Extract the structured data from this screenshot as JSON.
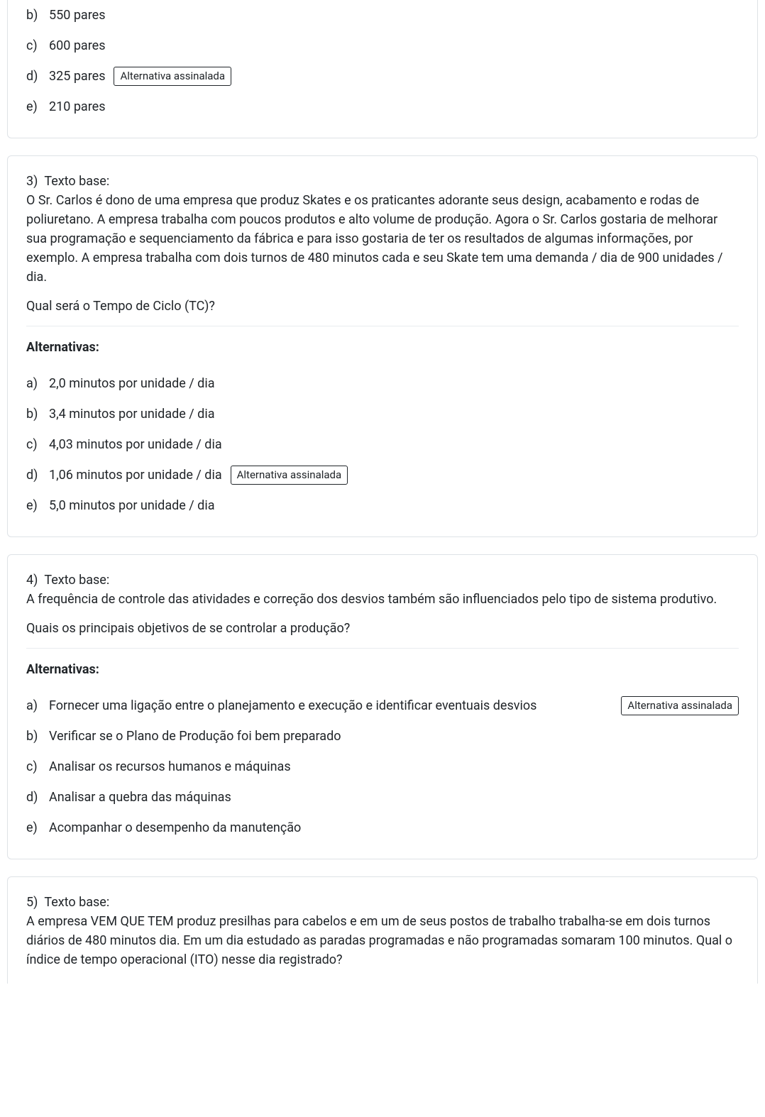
{
  "badgeLabel": "Alternativa assinalada",
  "q2": {
    "alts": [
      {
        "letter": "b)",
        "text": "550 pares",
        "marked": false
      },
      {
        "letter": "c)",
        "text": "600 pares",
        "marked": false
      },
      {
        "letter": "d)",
        "text": "325 pares",
        "marked": true
      },
      {
        "letter": "e)",
        "text": "210 pares",
        "marked": false
      }
    ]
  },
  "q3": {
    "number": "3)",
    "baseLabel": "Texto base:",
    "baseText": "O Sr. Carlos é dono de uma empresa que produz Skates e os praticantes adorante seus design, acabamento e rodas de poliuretano. A empresa trabalha com poucos produtos e alto volume de produção. Agora o Sr. Carlos gostaria de melhorar sua programação e sequenciamento da fábrica e para isso gostaria de ter os resultados de algumas informações, por exemplo. A empresa trabalha com dois turnos de 480 minutos cada e seu Skate tem uma demanda / dia de 900 unidades / dia.",
    "prompt": "Qual será o Tempo de Ciclo (TC)?",
    "altHeading": "Alternativas:",
    "alts": [
      {
        "letter": "a)",
        "text": "2,0 minutos por unidade / dia",
        "marked": false
      },
      {
        "letter": "b)",
        "text": "3,4 minutos por unidade / dia",
        "marked": false
      },
      {
        "letter": "c)",
        "text": "4,03 minutos por unidade / dia",
        "marked": false
      },
      {
        "letter": "d)",
        "text": "1,06 minutos por unidade / dia",
        "marked": true
      },
      {
        "letter": "e)",
        "text": "5,0 minutos por unidade / dia",
        "marked": false
      }
    ]
  },
  "q4": {
    "number": "4)",
    "baseLabel": "Texto base:",
    "baseText": "A frequência de controle das atividades e correção dos desvios também são influenciados pelo tipo de sistema produtivo.",
    "prompt": "Quais os principais objetivos de se controlar a produção?",
    "altHeading": "Alternativas:",
    "alts": [
      {
        "letter": "a)",
        "text": "Fornecer uma ligação entre o planejamento e execução e identificar eventuais desvios",
        "marked": true,
        "wide": true
      },
      {
        "letter": "b)",
        "text": "Verificar se o Plano de Produção foi bem preparado",
        "marked": false
      },
      {
        "letter": "c)",
        "text": "Analisar os recursos humanos e máquinas",
        "marked": false
      },
      {
        "letter": "d)",
        "text": "Analisar a quebra das máquinas",
        "marked": false
      },
      {
        "letter": "e)",
        "text": "Acompanhar o desempenho da manutenção",
        "marked": false
      }
    ]
  },
  "q5": {
    "number": "5)",
    "baseLabel": "Texto base:",
    "baseText": "A empresa VEM QUE TEM produz presilhas para cabelos e em um de seus postos de trabalho trabalha-se em dois turnos diários de 480 minutos dia. Em um dia estudado as paradas programadas e não programadas somaram 100 minutos. Qual o índice de tempo operacional (ITO) nesse dia registrado?"
  }
}
